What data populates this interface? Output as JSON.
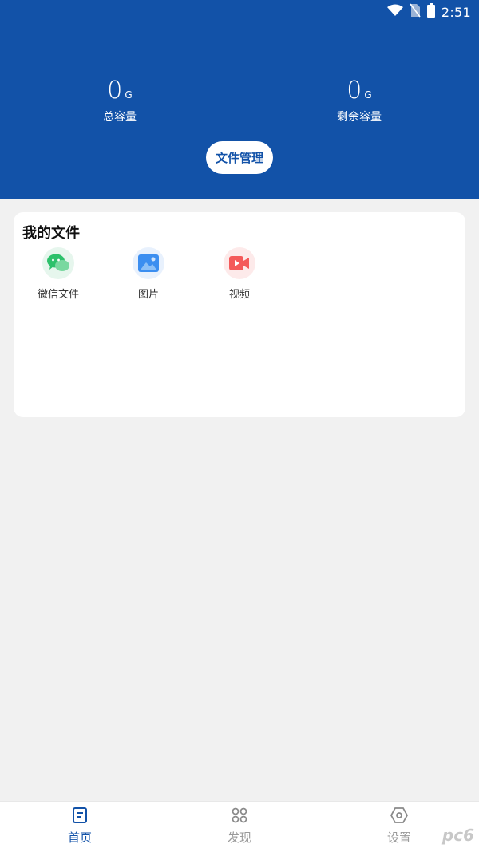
{
  "status_bar": {
    "time": "2:51",
    "icons": [
      "wifi-icon",
      "no-sim-icon",
      "battery-icon"
    ]
  },
  "storage": {
    "total": {
      "value": "0",
      "unit": "G",
      "label": "总容量"
    },
    "remaining": {
      "value": "0",
      "unit": "G",
      "label": "剩余容量"
    }
  },
  "file_manage_button": "文件管理",
  "my_files": {
    "title": "我的文件",
    "categories": [
      {
        "label": "微信文件",
        "icon": "wechat-icon",
        "color": "#2dc16b"
      },
      {
        "label": "图片",
        "icon": "image-icon",
        "color": "#3b8ef0"
      },
      {
        "label": "视频",
        "icon": "video-icon",
        "color": "#f45a5a"
      }
    ]
  },
  "tabs": [
    {
      "label": "首页",
      "icon": "document-icon",
      "active": true
    },
    {
      "label": "发现",
      "icon": "grid-command-icon",
      "active": false
    },
    {
      "label": "设置",
      "icon": "settings-hexagon-icon",
      "active": false
    }
  ],
  "colors": {
    "primary": "#1252a8",
    "background": "#f1f1f1",
    "card": "#ffffff"
  },
  "watermark": "pc6"
}
